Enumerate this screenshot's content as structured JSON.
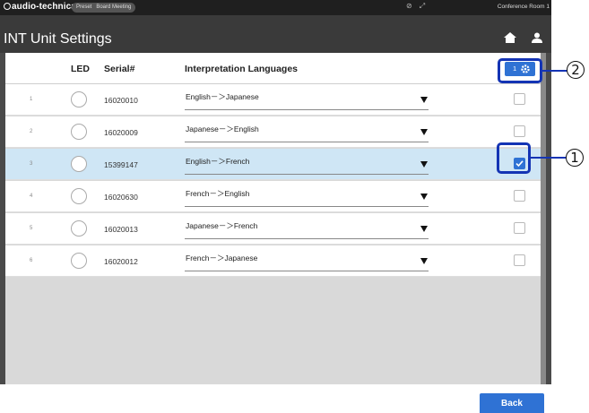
{
  "topbar": {
    "brand": "audio-technica",
    "preset_label": "Preset",
    "preset_name": "Board Meeting",
    "room": "Conference Room 1"
  },
  "page": {
    "title": "INT Unit Settings"
  },
  "table": {
    "headers": {
      "led": "LED",
      "serial": "Serial#",
      "languages": "Interpretation Languages"
    },
    "apply_all_count": "1",
    "rows": [
      {
        "no": "1",
        "serial": "16020010",
        "language": "English－＞Japanese",
        "checked": false
      },
      {
        "no": "2",
        "serial": "16020009",
        "language": "Japanese－＞English",
        "checked": false
      },
      {
        "no": "3",
        "serial": "15399147",
        "language": "English－＞French",
        "checked": true
      },
      {
        "no": "4",
        "serial": "16020630",
        "language": "French－＞English",
        "checked": false
      },
      {
        "no": "5",
        "serial": "16020013",
        "language": "Japanese－＞French",
        "checked": false
      },
      {
        "no": "6",
        "serial": "16020012",
        "language": "French－＞Japanese",
        "checked": false
      }
    ]
  },
  "footer": {
    "back_label": "Back"
  },
  "callouts": {
    "one": "1",
    "two": "2"
  },
  "icons": [
    "gear-icon",
    "home-icon",
    "user-icon",
    "dropdown-arrow-icon",
    "check-icon"
  ],
  "colors": {
    "accent": "#2f72d4",
    "selected_row": "#cfe6f5",
    "callout": "#1434b4",
    "topbar": "#1f1f1f",
    "titlebar": "#3a3a3a"
  }
}
